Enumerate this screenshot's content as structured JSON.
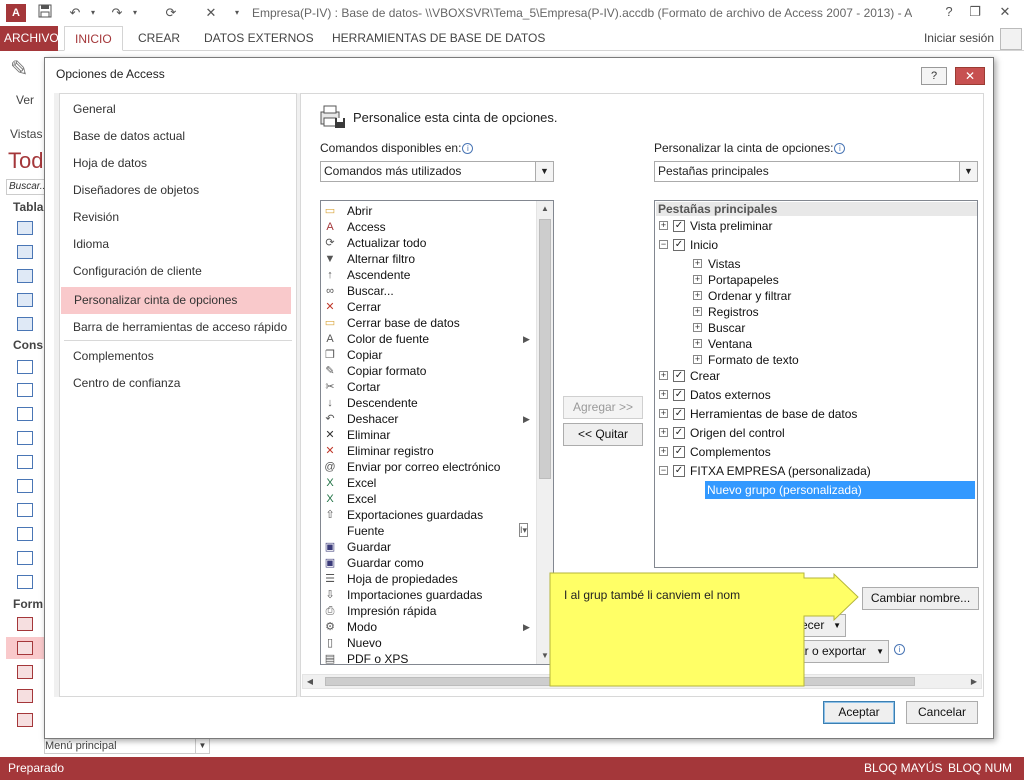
{
  "app": {
    "doc_title": "Empresa(P-IV) : Base de datos- \\\\VBOXSVR\\Tema_5\\Empresa(P-IV).accdb (Formato de archivo de Access 2007 - 2013) - A...",
    "logo": "A",
    "qat_icons": [
      "access-logo-icon",
      "save-icon",
      "undo-icon",
      "redo-icon",
      "customize-qat-icon",
      "cut-icon"
    ]
  },
  "ribbon": {
    "tabs": [
      "ARCHIVO",
      "INICIO",
      "CREAR",
      "DATOS EXTERNOS",
      "HERRAMIENTAS DE BASE DE DATOS"
    ],
    "active_tab": "INICIO",
    "signin": "Iniciar sesión"
  },
  "background": {
    "ver_label": "Ver",
    "vistas_label": "Vistas",
    "todos_label": "Tod",
    "buscar_placeholder": "Buscar...",
    "sections": [
      "Tabla",
      "Cons",
      "Form"
    ],
    "menu_principal": "Menú principal"
  },
  "status": {
    "left": "Preparado",
    "mayus": "BLOQ MAYÚS",
    "num": "BLOQ NUM"
  },
  "dialog": {
    "title": "Opciones de Access",
    "help_label": "?",
    "close_label": "✕",
    "nav": [
      "General",
      "Base de datos actual",
      "Hoja de datos",
      "Diseñadores de objetos",
      "Revisión",
      "Idioma",
      "Configuración de cliente",
      "Personalizar cinta de opciones",
      "Barra de herramientas de acceso rápido",
      "Complementos",
      "Centro de confianza"
    ],
    "selected_nav": "Personalizar cinta de opciones",
    "heading": "Personalice esta cinta de opciones.",
    "commands_label": "Comandos disponibles en:",
    "commands_combo": "Comandos más utilizados",
    "ribbon_label": "Personalizar la cinta de opciones:",
    "ribbon_combo": "Pestañas principales",
    "commands": [
      {
        "icon": "folder-icon",
        "label": "Abrir"
      },
      {
        "icon": "access-icon",
        "label": "Access"
      },
      {
        "icon": "refresh-icon",
        "label": "Actualizar todo"
      },
      {
        "icon": "filter-icon",
        "label": "Alternar filtro"
      },
      {
        "icon": "sort-ascending-icon",
        "label": "Ascendente"
      },
      {
        "icon": "binoculars-icon",
        "label": "Buscar..."
      },
      {
        "icon": "close-red-icon",
        "label": "Cerrar"
      },
      {
        "icon": "folder-close-icon",
        "label": "Cerrar base de datos"
      },
      {
        "icon": "font-color-icon",
        "label": "Color de fuente",
        "submenu": true
      },
      {
        "icon": "copy-icon",
        "label": "Copiar"
      },
      {
        "icon": "format-painter-icon",
        "label": "Copiar formato"
      },
      {
        "icon": "scissors-icon",
        "label": "Cortar"
      },
      {
        "icon": "sort-descending-icon",
        "label": "Descendente"
      },
      {
        "icon": "undo-icon",
        "label": "Deshacer",
        "submenu": true
      },
      {
        "icon": "delete-icon",
        "label": "Eliminar"
      },
      {
        "icon": "delete-record-icon",
        "label": "Eliminar registro"
      },
      {
        "icon": "email-attach-icon",
        "label": "Enviar por correo electrónico"
      },
      {
        "icon": "excel-icon",
        "label": "Excel"
      },
      {
        "icon": "excel-icon",
        "label": "Excel"
      },
      {
        "icon": "saved-exports-icon",
        "label": "Exportaciones guardadas"
      },
      {
        "icon": "",
        "label": "Fuente",
        "combo": true
      },
      {
        "icon": "save-icon",
        "label": "Guardar"
      },
      {
        "icon": "save-as-icon",
        "label": "Guardar como"
      },
      {
        "icon": "property-sheet-icon",
        "label": "Hoja de propiedades"
      },
      {
        "icon": "saved-imports-icon",
        "label": "Importaciones guardadas"
      },
      {
        "icon": "quick-print-icon",
        "label": "Impresión rápida"
      },
      {
        "icon": "mode-icon",
        "label": "Modo",
        "submenu": true
      },
      {
        "icon": "new-icon",
        "label": "Nuevo"
      },
      {
        "icon": "pdf-icon",
        "label": "PDF o XPS"
      }
    ],
    "add_button": "Agregar >>",
    "remove_button": "<< Quitar",
    "tree_header": "Pestañas principales",
    "tree": [
      {
        "label": "Vista preliminar",
        "level": 0,
        "exp": "+",
        "checked": true
      },
      {
        "label": "Inicio",
        "level": 0,
        "exp": "−",
        "checked": true
      },
      {
        "label": "Vistas",
        "level": 1,
        "exp": "+"
      },
      {
        "label": "Portapapeles",
        "level": 1,
        "exp": "+"
      },
      {
        "label": "Ordenar y filtrar",
        "level": 1,
        "exp": "+"
      },
      {
        "label": "Registros",
        "level": 1,
        "exp": "+"
      },
      {
        "label": "Buscar",
        "level": 1,
        "exp": "+"
      },
      {
        "label": "Ventana",
        "level": 1,
        "exp": "+"
      },
      {
        "label": "Formato de texto",
        "level": 1,
        "exp": "+"
      },
      {
        "label": "Crear",
        "level": 0,
        "exp": "+",
        "checked": true
      },
      {
        "label": "Datos externos",
        "level": 0,
        "exp": "+",
        "checked": true
      },
      {
        "label": "Herramientas de base de datos",
        "level": 0,
        "exp": "+",
        "checked": true
      },
      {
        "label": "Origen del control",
        "level": 0,
        "exp": "+",
        "checked": true
      },
      {
        "label": "Complementos",
        "level": 0,
        "exp": "+",
        "checked": true
      },
      {
        "label": "FITXA EMPRESA (personalizada)",
        "level": 0,
        "exp": "−",
        "checked": true
      },
      {
        "label": "Nuevo grupo (personalizada)",
        "level": 2,
        "selected": true
      }
    ],
    "rename_button": "Cambiar nombre...",
    "reset_partial": "ecer",
    "import_export_partial": "ar o exportar",
    "ok_button": "Aceptar",
    "cancel_button": "Cancelar"
  },
  "callout": {
    "text": "I al grup també li canviem el nom",
    "color": "#ffff66"
  },
  "colors": {
    "accent": "#a4373a",
    "selection": "#3399ff",
    "nav_selected": "#f9c9cb"
  }
}
